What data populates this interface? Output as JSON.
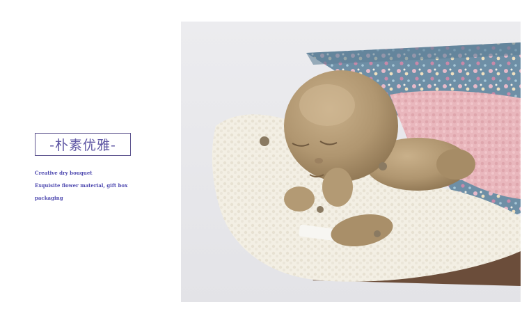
{
  "product": {
    "title": "-朴素优雅-",
    "lines": [
      "Creative dry bouquet",
      "Exquisite flower material, gift box",
      "packaging"
    ]
  },
  "colors": {
    "accent": "#5f57a4",
    "text": "#4f4ab0",
    "background": "#ffffff"
  }
}
